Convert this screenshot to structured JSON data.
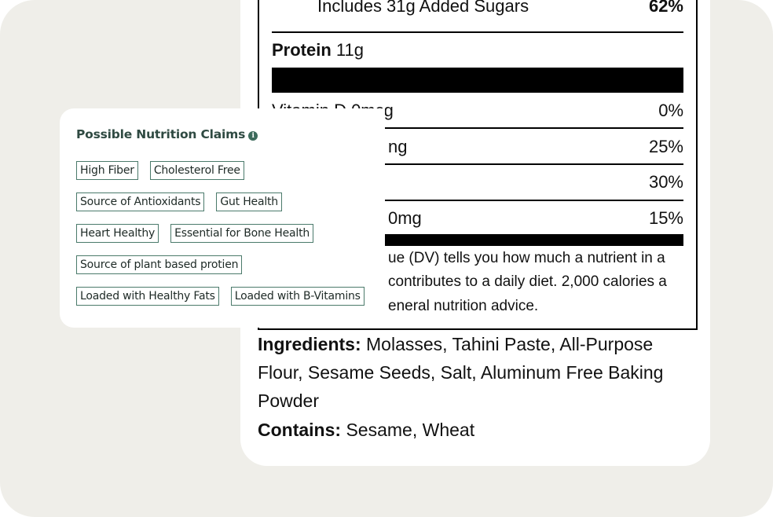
{
  "label": {
    "added_sugars": {
      "text": "Includes 31g Added Sugars",
      "pct": "62%"
    },
    "protein": {
      "name": "Protein",
      "amount": "11g"
    },
    "rows": [
      {
        "text": "Vitamin D 0mcg",
        "pct": "0%"
      },
      {
        "text": "ng",
        "pct": "25%"
      },
      {
        "text": "",
        "pct": "30%"
      },
      {
        "text": "0mg",
        "pct": "15%"
      }
    ],
    "footnote": [
      "ue (DV) tells you how much a nutrient in a",
      "contributes to a daily diet. 2,000 calories a",
      "eneral nutrition advice."
    ]
  },
  "ingredients": {
    "label": "Ingredients:",
    "text": "Molasses, Tahini Paste, All-Purpose Flour, Sesame Seeds, Salt, Aluminum Free Baking Powder",
    "contains_label": "Contains:",
    "contains": "Sesame, Wheat"
  },
  "claims": {
    "title": "Possible Nutrition Claims",
    "info_icon": "i",
    "rows": [
      [
        "High Fiber",
        "Cholesterol Free"
      ],
      [
        "Source of Antioxidants",
        "Gut Health"
      ],
      [
        "Heart Healthy",
        "Essential for Bone Health"
      ],
      [
        "Source of plant based protien"
      ],
      [
        "Loaded with Healthy Fats",
        "Loaded with B-Vitamins"
      ]
    ]
  },
  "colors": {
    "background": "#efeee9",
    "accent": "#3c6a5b"
  }
}
